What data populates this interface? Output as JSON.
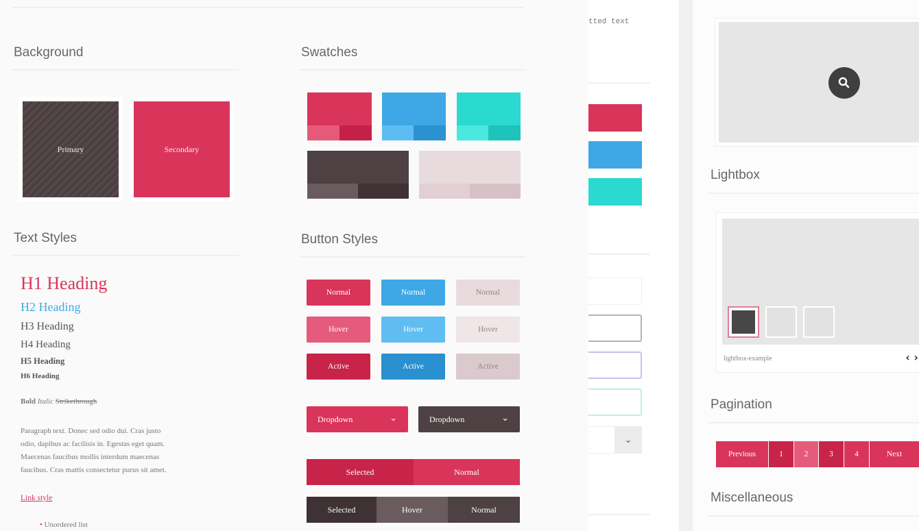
{
  "mid_truncated_text": "tted text",
  "background": {
    "title": "Background",
    "primary_label": "Primary",
    "secondary_label": "Secondary"
  },
  "swatches": {
    "title": "Swatches"
  },
  "text_styles": {
    "title": "Text Styles",
    "h1": "H1 Heading",
    "h2": "H2 Heading",
    "h3": "H3 Heading",
    "h4": "H4 Heading",
    "h5": "H5 Heading",
    "h6": "H6 Heading",
    "bold": "Bold",
    "italic": "Italic",
    "strike": "Strikethrough",
    "paragraph_lines": [
      "Paragraph text. Donec sed odio dui. Cras justo",
      "odio, dapibus ac facilisis in. Egestas eget quam.",
      "Maecenas faucibus mollis interdum maecenas",
      "faucibus. Cras mattis consectetur purus sit amet."
    ],
    "link": "Link style",
    "list_item": "Unordered list"
  },
  "button_styles": {
    "title": "Button Styles",
    "normal": "Normal",
    "hover": "Hover",
    "active": "Active",
    "dropdown": "Dropdown",
    "selected": "Selected"
  },
  "lightbox": {
    "title": "Lightbox",
    "caption": "lightbox-example",
    "prev_icon": "‹",
    "next_icon": "›"
  },
  "pagination": {
    "title": "Pagination",
    "previous": "Previous",
    "pages": [
      "1",
      "2",
      "3",
      "4"
    ],
    "next": "Next"
  },
  "misc": {
    "title": "Miscellaneous"
  },
  "colors": {
    "primary": "#d9345a",
    "blue": "#3ea8e6",
    "teal": "#2ad9d0",
    "dark": "#4d4143",
    "light": "#e7dbdd"
  }
}
